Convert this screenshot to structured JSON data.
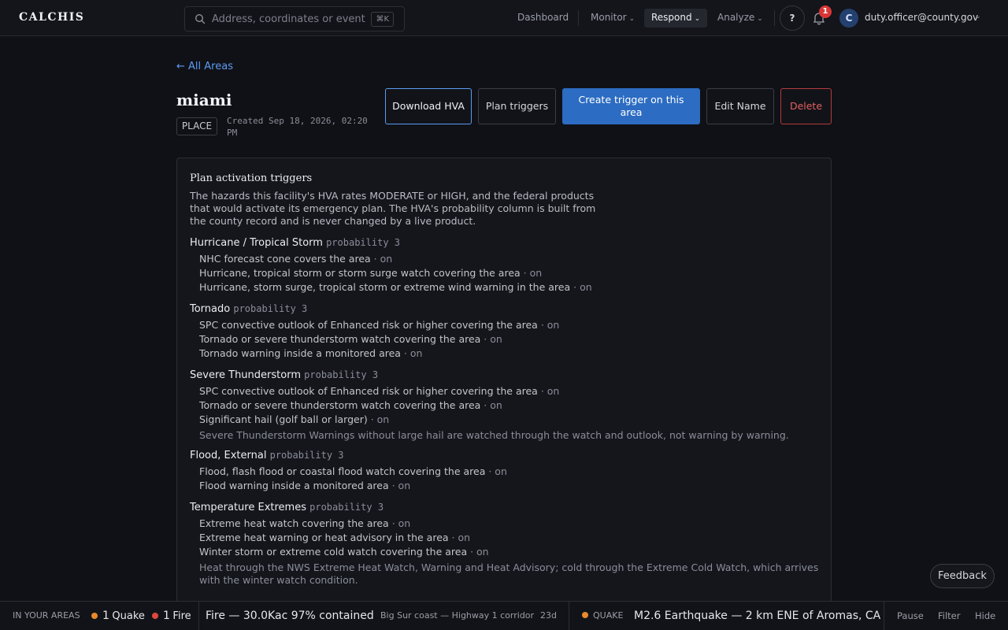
{
  "app": {
    "logo": "CALCHIS"
  },
  "search": {
    "placeholder": "Address, coordinates or event",
    "shortcut": "⌘K"
  },
  "nav": {
    "dashboard": "Dashboard",
    "monitor": "Monitor",
    "respond": "Respond",
    "analyze": "Analyze",
    "help": "?",
    "notification_count": "1",
    "avatar_initial": "C",
    "user_email": "duty.officer@county.gov"
  },
  "page": {
    "back_link": "← All Areas",
    "title": "miami",
    "tag": "PLACE",
    "created": "Created Sep 18, 2026, 02:20 PM"
  },
  "actions": {
    "download": "Download HVA",
    "plan": "Plan triggers",
    "create": "Create trigger on this area",
    "edit": "Edit Name",
    "delete": "Delete"
  },
  "panel": {
    "title": "Plan activation triggers",
    "description": "The hazards this facility's HVA rates MODERATE or HIGH, and the federal products that would activate its emergency plan. The HVA's probability column is built from the county record and is never changed by a live product.",
    "hazards": [
      {
        "name": "Hurricane / Tropical Storm",
        "probability": "probability 3",
        "triggers": [
          {
            "text": "NHC forecast cone covers the area",
            "status": " · on"
          },
          {
            "text": "Hurricane, tropical storm or storm surge watch covering the area",
            "status": " · on"
          },
          {
            "text": "Hurricane, storm surge, tropical storm or extreme wind warning in the area",
            "status": " · on"
          }
        ]
      },
      {
        "name": "Tornado",
        "probability": "probability 3",
        "triggers": [
          {
            "text": "SPC convective outlook of Enhanced risk or higher covering the area",
            "status": " · on"
          },
          {
            "text": "Tornado or severe thunderstorm watch covering the area",
            "status": " · on"
          },
          {
            "text": "Tornado warning inside a monitored area",
            "status": " · on"
          }
        ]
      },
      {
        "name": "Severe Thunderstorm",
        "probability": "probability 3",
        "triggers": [
          {
            "text": "SPC convective outlook of Enhanced risk or higher covering the area",
            "status": " · on"
          },
          {
            "text": "Tornado or severe thunderstorm watch covering the area",
            "status": " · on"
          },
          {
            "text": "Significant hail (golf ball or larger)",
            "status": " · on"
          }
        ],
        "note": "Severe Thunderstorm Warnings without large hail are watched through the watch and outlook, not warning by warning."
      },
      {
        "name": "Flood, External",
        "probability": "probability 3",
        "triggers": [
          {
            "text": "Flood, flash flood or coastal flood watch covering the area",
            "status": " · on"
          },
          {
            "text": "Flood warning inside a monitored area",
            "status": " · on"
          }
        ]
      },
      {
        "name": "Temperature Extremes",
        "probability": "probability 3",
        "triggers": [
          {
            "text": "Extreme heat watch covering the area",
            "status": " · on"
          },
          {
            "text": "Extreme heat warning or heat advisory in the area",
            "status": " · on"
          },
          {
            "text": "Winter storm or extreme cold watch covering the area",
            "status": " · on"
          }
        ],
        "note": "Heat through the NWS Extreme Heat Watch, Warning and Heat Advisory; cold through the Extreme Cold Watch, which arrives with the winter watch condition."
      }
    ]
  },
  "feedback": "Feedback",
  "ticker": {
    "label": "IN YOUR AREAS",
    "quake_count": "1",
    "quake_label": "Quake",
    "fire_count": "1",
    "fire_label": "Fire",
    "fire_headline": "Fire — 30.0Kac 97% contained",
    "fire_location": "Big Sur coast — Highway 1 corridor",
    "fire_age": "23d",
    "quake_type": "QUAKE",
    "quake_headline": "M2.6 Earthquake — 2 km ENE of Aromas, CA",
    "pause": "Pause",
    "filter": "Filter",
    "hide": "Hide"
  },
  "colors": {
    "accent": "#2c6cc2",
    "link": "#5b9cf2",
    "danger": "#d93636",
    "quake": "#e8892b",
    "fire": "#e0483d"
  }
}
